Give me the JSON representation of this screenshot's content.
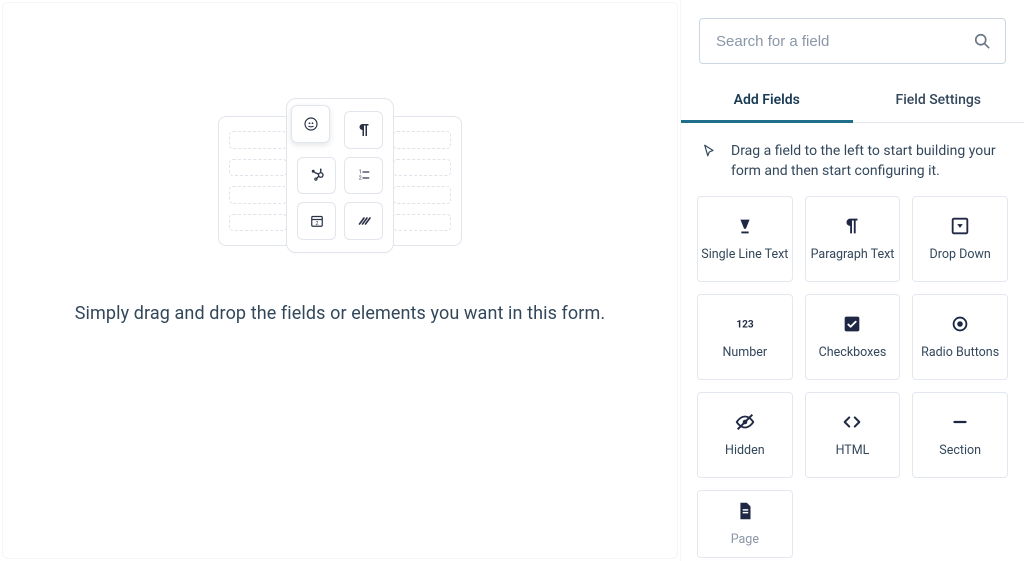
{
  "canvas": {
    "caption": "Simply drag and drop the fields or elements you want in this form."
  },
  "sidebar": {
    "search": {
      "placeholder": "Search for a field"
    },
    "tabs": {
      "add_fields": "Add Fields",
      "field_settings": "Field Settings",
      "active": "add_fields"
    },
    "hint": "Drag a field to the left to start building your form and then start configuring it.",
    "fields": [
      {
        "id": "single-line-text",
        "label": "Single Line Text",
        "icon": "text-underline"
      },
      {
        "id": "paragraph-text",
        "label": "Paragraph Text",
        "icon": "pilcrow"
      },
      {
        "id": "drop-down",
        "label": "Drop Down",
        "icon": "dropdown-box"
      },
      {
        "id": "number",
        "label": "Number",
        "icon": "one-two-three"
      },
      {
        "id": "checkboxes",
        "label": "Checkboxes",
        "icon": "checkbox"
      },
      {
        "id": "radio-buttons",
        "label": "Radio Buttons",
        "icon": "radio"
      },
      {
        "id": "hidden",
        "label": "Hidden",
        "icon": "eye-off"
      },
      {
        "id": "html",
        "label": "HTML",
        "icon": "code"
      },
      {
        "id": "section",
        "label": "Section",
        "icon": "minus"
      },
      {
        "id": "page",
        "label": "Page",
        "icon": "page"
      }
    ]
  }
}
